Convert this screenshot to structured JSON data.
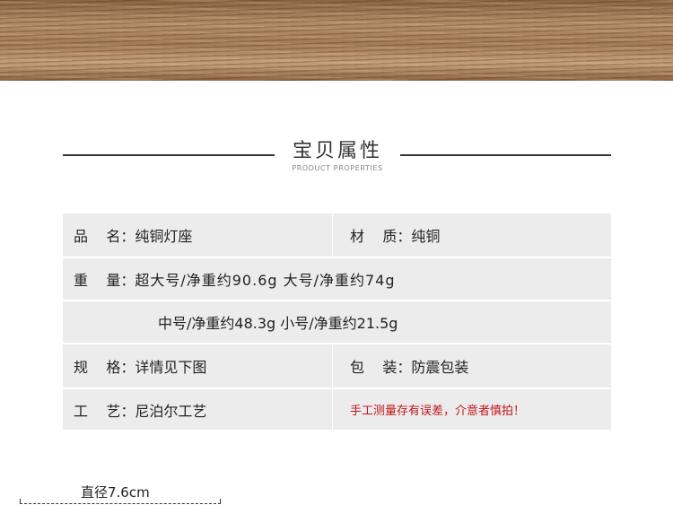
{
  "title": {
    "cn": "宝贝属性",
    "en": "PRODUCT PROPERTIES"
  },
  "rows": [
    {
      "left_label": "品    名：",
      "left_value": "纯铜灯座",
      "right_label": "材    质：",
      "right_value": "纯铜"
    },
    {
      "left_label": "重    量：",
      "left_value": "超大号/净重约90.6g 大号/净重约74g"
    },
    {
      "left_value": "中号/净重约48.3g 小号/净重约21.5g"
    },
    {
      "left_label": "规    格：",
      "left_value": "详情见下图",
      "right_label": "包    装：",
      "right_value": "防震包装"
    },
    {
      "left_label": "工    艺：",
      "left_value": "尼泊尔工艺",
      "right_value": "手工测量存有误差，介意者慎拍！"
    }
  ],
  "diameter": "直径7.6cm",
  "colors": {
    "warn": "#c0161b",
    "row_bg": "#ececec"
  }
}
